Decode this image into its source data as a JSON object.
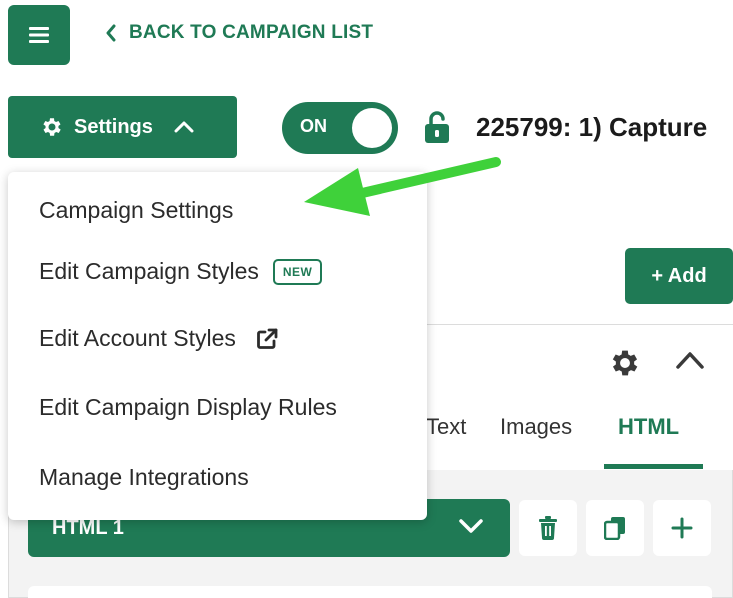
{
  "header": {
    "back_label": "BACK TO CAMPAIGN LIST"
  },
  "toolbar": {
    "settings_label": "Settings",
    "toggle_label": "ON",
    "campaign_title": "225799: 1) Capture"
  },
  "dropdown": {
    "items": [
      {
        "label": "Campaign Settings"
      },
      {
        "label": "Edit Campaign Styles",
        "badge": "NEW"
      },
      {
        "label": "Edit Account Styles"
      },
      {
        "label": "Edit Campaign Display Rules"
      },
      {
        "label": "Manage Integrations"
      }
    ]
  },
  "page": {
    "add_label": "+ Add",
    "tabs": [
      "Text",
      "Images",
      "HTML"
    ],
    "active_tab": "HTML",
    "html_select_value": "HTML 1"
  },
  "colors": {
    "brand_green": "#1f7a55",
    "annotation_arrow": "#3fd13a"
  },
  "icons": [
    "hamburger-icon",
    "chevron-left-icon",
    "gear-icon",
    "chevron-up-icon",
    "unlock-icon",
    "external-link-icon",
    "chevron-down-icon",
    "trash-icon",
    "copy-icon",
    "plus-icon"
  ]
}
